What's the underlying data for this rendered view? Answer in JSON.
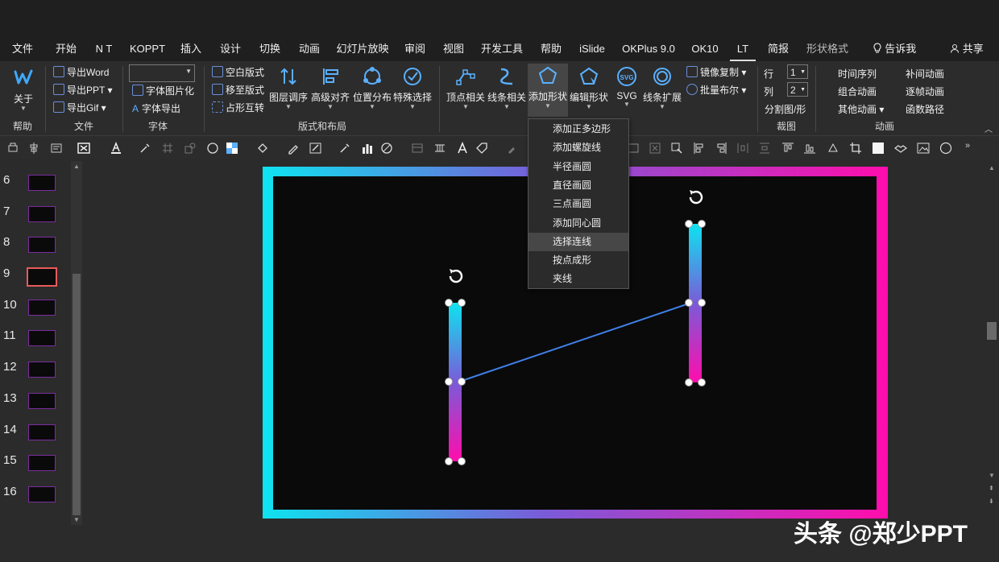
{
  "menu": {
    "file": "文件",
    "home": "开始",
    "nt": "N T",
    "koppt": "KOPPT",
    "insert": "插入",
    "design": "设计",
    "transitions": "切换",
    "animations": "动画",
    "slideshow": "幻灯片放映",
    "review": "审阅",
    "view": "视图",
    "developer": "开发工具",
    "help": "帮助",
    "islide": "iSlide",
    "okplus": "OKPlus 9.0",
    "ok10": "OK10",
    "lt": "LT",
    "jianbao": "简报",
    "shape_format": "形状格式",
    "tell_me": "告诉我",
    "share": "共享"
  },
  "ribbon": {
    "about": "关于",
    "export_word": "导出Word",
    "export_ppt": "导出PPT",
    "export_gif": "导出Gif",
    "font_image": "字体图片化",
    "font_export": "字体导出",
    "blank_layout": "空白版式",
    "move_to_layout": "移至版式",
    "placeholder_swap": "占形互转",
    "layer_order": "图层调序",
    "advanced_align": "高级对齐",
    "position_distribute": "位置分布",
    "special_select": "特殊选择",
    "vertex": "顶点相关",
    "line": "线条相关",
    "add_shape": "添加形状",
    "edit_shape": "编辑形状",
    "svg": "SVG",
    "line_expand": "线条扩展",
    "mirror_copy": "镜像复制",
    "batch_boolean": "批量布尔",
    "row_label": "行",
    "row_value": "1",
    "col_label": "列",
    "col_value": "2",
    "split_shape": "分割图/形",
    "timeline": "时间序列",
    "combo_anim": "组合动画",
    "other_anim": "其他动画",
    "tween_anim": "补间动画",
    "frame_anim": "逐帧动画",
    "func_path": "函数路径",
    "groups": {
      "help": "帮助",
      "file": "文件",
      "font": "字体",
      "layout": "版式和布局",
      "crop": "裁图",
      "anim": "动画"
    }
  },
  "dropdown": {
    "items": [
      "添加正多边形",
      "添加螺旋线",
      "半径画圆",
      "直径画圆",
      "三点画圆",
      "添加同心圆",
      "选择连线",
      "按点成形",
      "夹线"
    ],
    "highlighted_index": 6
  },
  "thumbnails": {
    "numbers": [
      "6",
      "7",
      "8",
      "9",
      "10",
      "11",
      "12",
      "13",
      "14",
      "15",
      "16"
    ],
    "selected": "9"
  },
  "colors": {
    "accent_cyan": "#0ee3f0",
    "accent_magenta": "#ff0dac",
    "connector": "#3f7fe6"
  },
  "watermark": "头条 @郑少PPT"
}
